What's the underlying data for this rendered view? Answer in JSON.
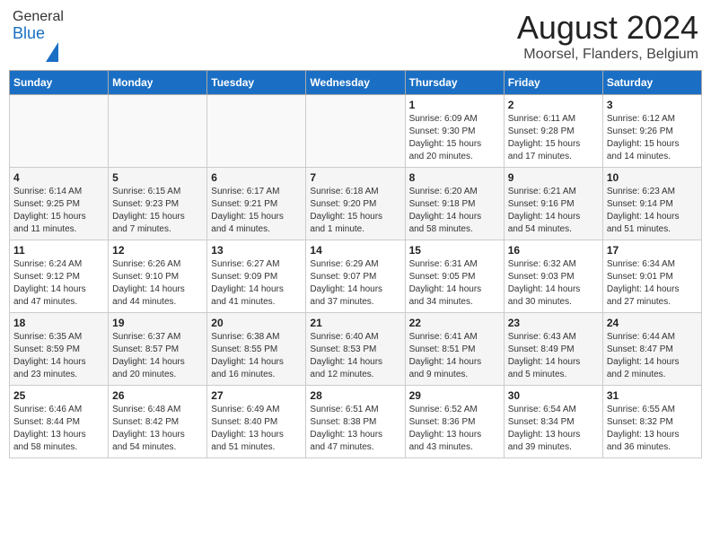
{
  "header": {
    "logo_line1": "General",
    "logo_line2": "Blue",
    "main_title": "August 2024",
    "subtitle": "Moorsel, Flanders, Belgium"
  },
  "calendar": {
    "days_of_week": [
      "Sunday",
      "Monday",
      "Tuesday",
      "Wednesday",
      "Thursday",
      "Friday",
      "Saturday"
    ],
    "weeks": [
      [
        {
          "day": "",
          "detail": ""
        },
        {
          "day": "",
          "detail": ""
        },
        {
          "day": "",
          "detail": ""
        },
        {
          "day": "",
          "detail": ""
        },
        {
          "day": "1",
          "detail": "Sunrise: 6:09 AM\nSunset: 9:30 PM\nDaylight: 15 hours\nand 20 minutes."
        },
        {
          "day": "2",
          "detail": "Sunrise: 6:11 AM\nSunset: 9:28 PM\nDaylight: 15 hours\nand 17 minutes."
        },
        {
          "day": "3",
          "detail": "Sunrise: 6:12 AM\nSunset: 9:26 PM\nDaylight: 15 hours\nand 14 minutes."
        }
      ],
      [
        {
          "day": "4",
          "detail": "Sunrise: 6:14 AM\nSunset: 9:25 PM\nDaylight: 15 hours\nand 11 minutes."
        },
        {
          "day": "5",
          "detail": "Sunrise: 6:15 AM\nSunset: 9:23 PM\nDaylight: 15 hours\nand 7 minutes."
        },
        {
          "day": "6",
          "detail": "Sunrise: 6:17 AM\nSunset: 9:21 PM\nDaylight: 15 hours\nand 4 minutes."
        },
        {
          "day": "7",
          "detail": "Sunrise: 6:18 AM\nSunset: 9:20 PM\nDaylight: 15 hours\nand 1 minute."
        },
        {
          "day": "8",
          "detail": "Sunrise: 6:20 AM\nSunset: 9:18 PM\nDaylight: 14 hours\nand 58 minutes."
        },
        {
          "day": "9",
          "detail": "Sunrise: 6:21 AM\nSunset: 9:16 PM\nDaylight: 14 hours\nand 54 minutes."
        },
        {
          "day": "10",
          "detail": "Sunrise: 6:23 AM\nSunset: 9:14 PM\nDaylight: 14 hours\nand 51 minutes."
        }
      ],
      [
        {
          "day": "11",
          "detail": "Sunrise: 6:24 AM\nSunset: 9:12 PM\nDaylight: 14 hours\nand 47 minutes."
        },
        {
          "day": "12",
          "detail": "Sunrise: 6:26 AM\nSunset: 9:10 PM\nDaylight: 14 hours\nand 44 minutes."
        },
        {
          "day": "13",
          "detail": "Sunrise: 6:27 AM\nSunset: 9:09 PM\nDaylight: 14 hours\nand 41 minutes."
        },
        {
          "day": "14",
          "detail": "Sunrise: 6:29 AM\nSunset: 9:07 PM\nDaylight: 14 hours\nand 37 minutes."
        },
        {
          "day": "15",
          "detail": "Sunrise: 6:31 AM\nSunset: 9:05 PM\nDaylight: 14 hours\nand 34 minutes."
        },
        {
          "day": "16",
          "detail": "Sunrise: 6:32 AM\nSunset: 9:03 PM\nDaylight: 14 hours\nand 30 minutes."
        },
        {
          "day": "17",
          "detail": "Sunrise: 6:34 AM\nSunset: 9:01 PM\nDaylight: 14 hours\nand 27 minutes."
        }
      ],
      [
        {
          "day": "18",
          "detail": "Sunrise: 6:35 AM\nSunset: 8:59 PM\nDaylight: 14 hours\nand 23 minutes."
        },
        {
          "day": "19",
          "detail": "Sunrise: 6:37 AM\nSunset: 8:57 PM\nDaylight: 14 hours\nand 20 minutes."
        },
        {
          "day": "20",
          "detail": "Sunrise: 6:38 AM\nSunset: 8:55 PM\nDaylight: 14 hours\nand 16 minutes."
        },
        {
          "day": "21",
          "detail": "Sunrise: 6:40 AM\nSunset: 8:53 PM\nDaylight: 14 hours\nand 12 minutes."
        },
        {
          "day": "22",
          "detail": "Sunrise: 6:41 AM\nSunset: 8:51 PM\nDaylight: 14 hours\nand 9 minutes."
        },
        {
          "day": "23",
          "detail": "Sunrise: 6:43 AM\nSunset: 8:49 PM\nDaylight: 14 hours\nand 5 minutes."
        },
        {
          "day": "24",
          "detail": "Sunrise: 6:44 AM\nSunset: 8:47 PM\nDaylight: 14 hours\nand 2 minutes."
        }
      ],
      [
        {
          "day": "25",
          "detail": "Sunrise: 6:46 AM\nSunset: 8:44 PM\nDaylight: 13 hours\nand 58 minutes."
        },
        {
          "day": "26",
          "detail": "Sunrise: 6:48 AM\nSunset: 8:42 PM\nDaylight: 13 hours\nand 54 minutes."
        },
        {
          "day": "27",
          "detail": "Sunrise: 6:49 AM\nSunset: 8:40 PM\nDaylight: 13 hours\nand 51 minutes."
        },
        {
          "day": "28",
          "detail": "Sunrise: 6:51 AM\nSunset: 8:38 PM\nDaylight: 13 hours\nand 47 minutes."
        },
        {
          "day": "29",
          "detail": "Sunrise: 6:52 AM\nSunset: 8:36 PM\nDaylight: 13 hours\nand 43 minutes."
        },
        {
          "day": "30",
          "detail": "Sunrise: 6:54 AM\nSunset: 8:34 PM\nDaylight: 13 hours\nand 39 minutes."
        },
        {
          "day": "31",
          "detail": "Sunrise: 6:55 AM\nSunset: 8:32 PM\nDaylight: 13 hours\nand 36 minutes."
        }
      ]
    ]
  }
}
